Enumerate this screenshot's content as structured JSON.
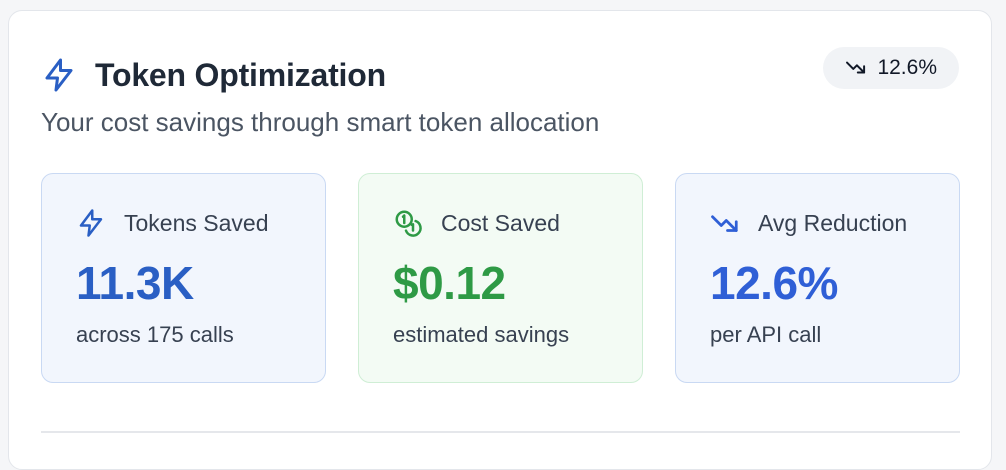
{
  "header": {
    "title": "Token Optimization",
    "icon": "lightning-bolt-icon",
    "subtitle": "Your cost savings through smart token allocation",
    "badge": {
      "icon": "trending-down-icon",
      "text": "12.6%"
    }
  },
  "stats": [
    {
      "icon": "lightning-bolt-icon",
      "label": "Tokens Saved",
      "value": "11.3K",
      "sub": "across 175 calls",
      "color": "#2a5fc4"
    },
    {
      "icon": "coins-icon",
      "label": "Cost Saved",
      "value": "$0.12",
      "sub": "estimated savings",
      "color": "#2e9a45"
    },
    {
      "icon": "trending-down-icon",
      "label": "Avg Reduction",
      "value": "12.6%",
      "sub": "per API call",
      "color": "#2f5fd6"
    }
  ],
  "colors": {
    "blue_accent": "#2a5fc4",
    "green_accent": "#2e9a45",
    "indigo_accent": "#2f5fd6",
    "card_border": "#e3e6eb"
  }
}
